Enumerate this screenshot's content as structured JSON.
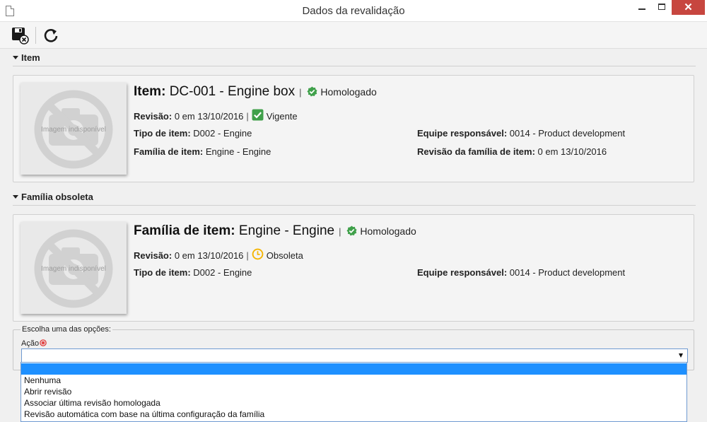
{
  "window": {
    "title": "Dados da revalidação",
    "close_label": "✕"
  },
  "colors": {
    "green_status": "#3fa04a",
    "clock_yellow": "#f4b400",
    "selection_blue": "#1e90ff",
    "close_red": "#c7463f"
  },
  "toolbar": {
    "save_icon": "save-close-icon",
    "refresh_icon": "refresh-icon"
  },
  "item_section": {
    "header": "Item",
    "photo_placeholder": "Imagem indisponível",
    "title_key": "Item:",
    "title_value": "DC-001 - Engine box",
    "separator": "|",
    "status": "Homologado",
    "revision_key": "Revisão:",
    "revision_value": "0 em 13/10/2016",
    "revision_status": "Vigente",
    "type_key": "Tipo de item:",
    "type_value": "D002 - Engine",
    "team_key": "Equipe responsável:",
    "team_value": "0014 - Product development",
    "family_key": "Família de item:",
    "family_value": "Engine - Engine",
    "family_rev_key": "Revisão da família de item:",
    "family_rev_value": "0 em 13/10/2016"
  },
  "family_section": {
    "header": "Família obsoleta",
    "photo_placeholder": "Imagem indisponível",
    "title_key": "Família de item:",
    "title_value": "Engine - Engine",
    "separator": "|",
    "status": "Homologado",
    "revision_key": "Revisão:",
    "revision_value": "0 em 13/10/2016",
    "revision_status": "Obsoleta",
    "type_key": "Tipo de item:",
    "type_value": "D002 - Engine",
    "team_key": "Equipe responsável:",
    "team_value": "0014 - Product development"
  },
  "options": {
    "legend": "Escolha uma das opções:",
    "action_label": "Ação",
    "selected_value": "",
    "items": [
      "",
      "Nenhuma",
      "Abrir revisão",
      "Associar última revisão homologada",
      "Revisão automática com base na última configuração da família"
    ]
  }
}
